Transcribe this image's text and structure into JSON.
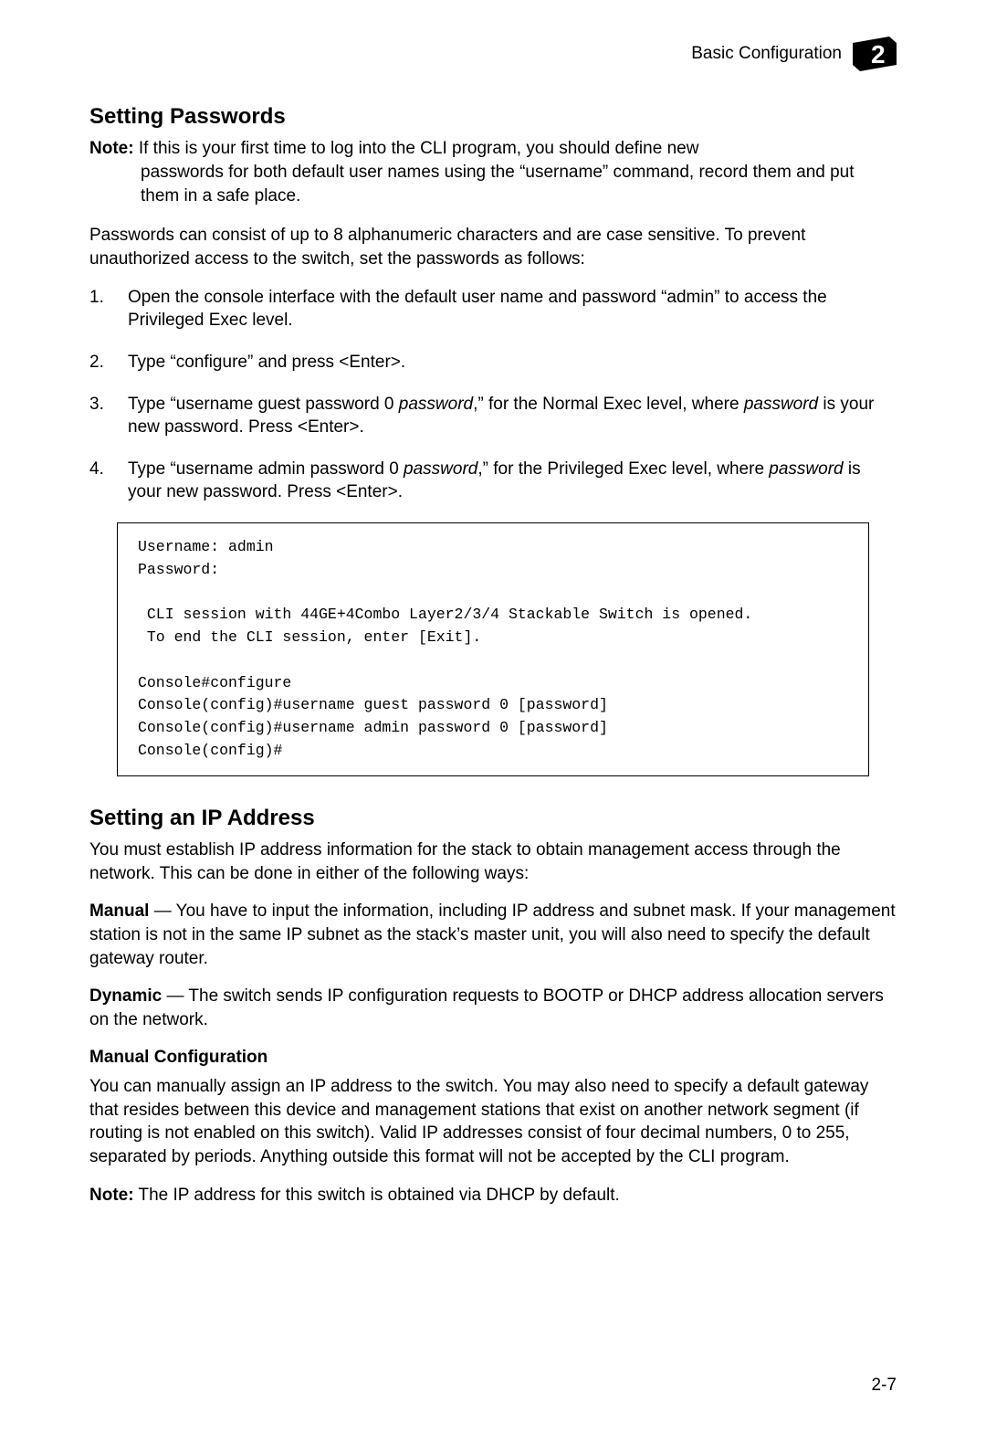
{
  "header": {
    "title": "Basic Configuration",
    "chapter_number": "2"
  },
  "section1": {
    "heading": "Setting Passwords",
    "note_label": "Note:",
    "note_text_line1": "If this is your first time to log into the CLI program, you should define new",
    "note_text_line2": "passwords for both default user names using the “username” command, record them and put them in a safe place.",
    "para1": "Passwords can consist of up to 8 alphanumeric characters and are case sensitive. To prevent unauthorized access to the switch, set the passwords as follows:",
    "steps": {
      "s1": "Open the console interface with the default user name and password “admin” to access the Privileged Exec level.",
      "s2": "Type “configure” and press <Enter>.",
      "s3_a": "Type “username guest password 0 ",
      "s3_i": "password",
      "s3_b": ",” for the Normal Exec level, where ",
      "s3_i2": "password",
      "s3_c": " is your new password. Press <Enter>.",
      "s4_a": "Type “username admin password 0 ",
      "s4_i": "password",
      "s4_b": ",” for the Privileged Exec level, where ",
      "s4_i2": "password",
      "s4_c": " is your new password. Press <Enter>."
    },
    "code": "Username: admin\nPassword:\n\n CLI session with 44GE+4Combo Layer2/3/4 Stackable Switch is opened.\n To end the CLI session, enter [Exit].\n\nConsole#configure\nConsole(config)#username guest password 0 [password]\nConsole(config)#username admin password 0 [password]\nConsole(config)#"
  },
  "section2": {
    "heading": "Setting an IP Address",
    "para1": "You must establish IP address information for the stack to obtain management access through the network. This can be done in either of the following ways:",
    "manual_label": "Manual",
    "manual_text": " — You have to input the information, including IP address and subnet mask. If your management station is not in the same IP subnet as the stack’s master unit, you will also need to specify the default gateway router.",
    "dynamic_label": "Dynamic",
    "dynamic_text": " — The switch sends IP configuration requests to BOOTP or DHCP address allocation servers on the network.",
    "subheading": "Manual Configuration",
    "para2": "You can manually assign an IP address to the switch. You may also need to specify a default gateway that resides between this device and management stations that exist on another network segment (if routing is not enabled on this switch). Valid IP addresses consist of four decimal numbers, 0 to 255, separated by periods. Anything outside this format will not be accepted by the CLI program.",
    "note_label": "Note:",
    "note_text": " The IP address for this switch is obtained via DHCP by default."
  },
  "page_number": "2-7"
}
